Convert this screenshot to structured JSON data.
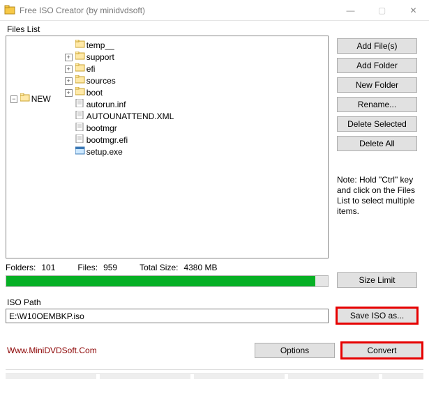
{
  "window": {
    "title": "Free ISO Creator (by minidvdsoft)"
  },
  "labels": {
    "files_list": "Files List",
    "iso_path": "ISO Path",
    "folders": "Folders:",
    "files": "Files:",
    "total_size": "Total Size:"
  },
  "tree": {
    "root": "NEW",
    "children": [
      {
        "name": "temp__",
        "type": "folder",
        "expandable": false
      },
      {
        "name": "support",
        "type": "folder",
        "expandable": true
      },
      {
        "name": "efi",
        "type": "folder",
        "expandable": true
      },
      {
        "name": "sources",
        "type": "folder",
        "expandable": true
      },
      {
        "name": "boot",
        "type": "folder",
        "expandable": true
      },
      {
        "name": "autorun.inf",
        "type": "file"
      },
      {
        "name": "AUTOUNATTEND.XML",
        "type": "file"
      },
      {
        "name": "bootmgr",
        "type": "file"
      },
      {
        "name": "bootmgr.efi",
        "type": "file"
      },
      {
        "name": "setup.exe",
        "type": "exe"
      }
    ]
  },
  "buttons": {
    "add_files": "Add File(s)",
    "add_folder": "Add Folder",
    "new_folder": "New Folder",
    "rename": "Rename...",
    "delete_selected": "Delete Selected",
    "delete_all": "Delete All",
    "size_limit": "Size Limit",
    "save_iso": "Save ISO as...",
    "options": "Options",
    "convert": "Convert"
  },
  "note": "Note: Hold \"Ctrl\" key and click on the Files List to select multiple items.",
  "stats": {
    "folders": "101",
    "files": "959",
    "total_size": "4380 MB",
    "progress_pct": 96
  },
  "iso_path_value": "E:\\W10OEMBKP.iso",
  "footer_link": "Www.MiniDVDSoft.Com"
}
